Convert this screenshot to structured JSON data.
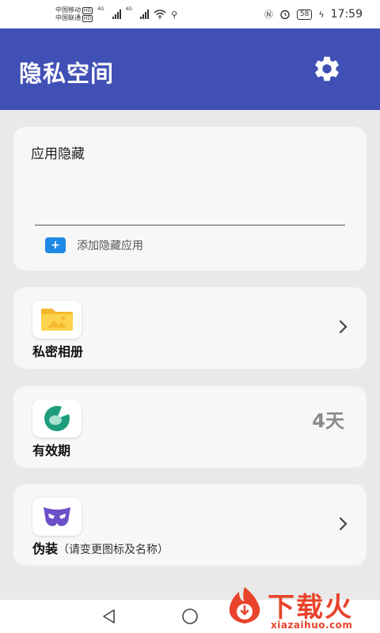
{
  "status_bar": {
    "carrier1": "中国移动",
    "carrier2": "中国联通",
    "hd_badge": "HD",
    "signal1_label": "4G",
    "signal2_label": "4G",
    "battery": "58",
    "time": "17:59"
  },
  "app_bar": {
    "title": "隐私空间",
    "settings_icon": "gear-icon"
  },
  "hidden_apps": {
    "title": "应用隐藏",
    "add_label": "添加隐藏应用"
  },
  "items": {
    "album": {
      "label": "私密相册",
      "icon": "folder-image-icon"
    },
    "validity": {
      "label": "有效期",
      "value": "4天",
      "icon": "timer-icon"
    },
    "disguise": {
      "label": "伪装",
      "sub": "（请变更图标及名称）",
      "icon": "mask-icon"
    }
  },
  "watermark": {
    "text": "下载火",
    "url": "xiazaihuo.com"
  },
  "colors": {
    "app_bar": "#4050b5",
    "accent_blue": "#1e88e5",
    "watermark": "#e8432b"
  }
}
